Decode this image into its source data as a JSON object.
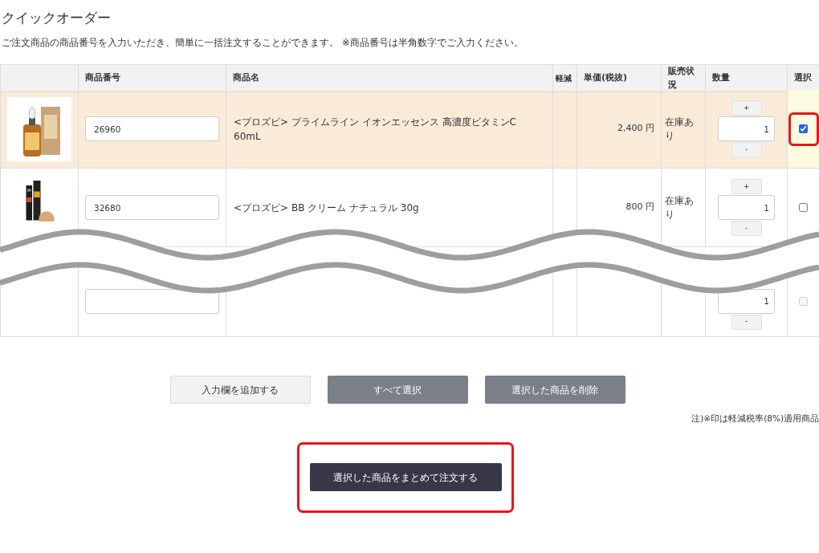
{
  "page": {
    "title": "クイックオーダー",
    "description": "ご注文商品の商品番号を入力いただき、簡単に一括注文することができます。 ※商品番号は半角数字でご入力ください。"
  },
  "table": {
    "columns": [
      "商品番号",
      "商品名",
      "軽減",
      "単価(税抜)",
      "販売状況",
      "数量",
      "選択"
    ],
    "rows": [
      {
        "product_number": "26960",
        "name": "<プロズビ> プライムライン イオンエッセンス 高濃度ビタミンC 60mL",
        "price": "2,400 円",
        "status": "在庫あり",
        "quantity": "1",
        "plus": "+",
        "minus": "-",
        "checked": true,
        "disabled": false,
        "highlighted": true
      },
      {
        "product_number": "32680",
        "name": "<プロズビ> BB クリーム ナチュラル 30g",
        "price": "800 円",
        "status": "在庫あり",
        "quantity": "1",
        "plus": "+",
        "minus": "-",
        "checked": false,
        "disabled": false,
        "highlighted": false
      },
      {
        "quantity": "1",
        "minus": "-",
        "checked": false,
        "disabled": true,
        "highlighted": false
      }
    ]
  },
  "actions": [
    {
      "label": "入力欄を追加する",
      "kind": "light"
    },
    {
      "label": "すべて選択",
      "kind": "dark"
    },
    {
      "label": "選択した商品を削除",
      "kind": "dark"
    }
  ],
  "note": "注)※印は軽減税率(8%)適用商品",
  "order_button": {
    "label": "選択した商品をまとめて注文する",
    "highlighted": true
  }
}
